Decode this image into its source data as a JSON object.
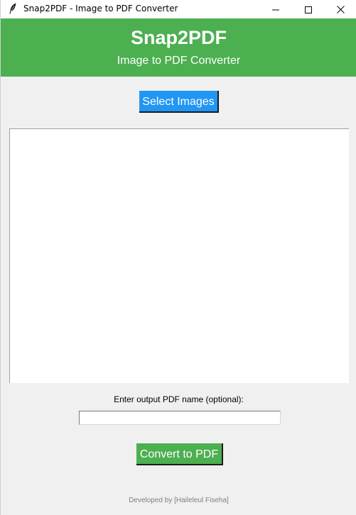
{
  "window": {
    "title": "Snap2PDF - Image to PDF Converter",
    "icon": "feather-icon"
  },
  "window_controls": {
    "minimize_icon": "minimize-icon",
    "maximize_icon": "maximize-icon",
    "close_icon": "close-icon"
  },
  "header": {
    "title": "Snap2PDF",
    "subtitle": "Image to PDF Converter",
    "background_color": "#4caf50"
  },
  "actions": {
    "select_images_label": "Select Images",
    "select_images_color": "#2196f3",
    "convert_label": "Convert to PDF",
    "convert_color": "#4caf50"
  },
  "image_list": {
    "items": []
  },
  "output": {
    "label": "Enter output PDF name (optional):",
    "value": ""
  },
  "footer": {
    "text": "Developed by [Haileleul Fiseha]"
  }
}
